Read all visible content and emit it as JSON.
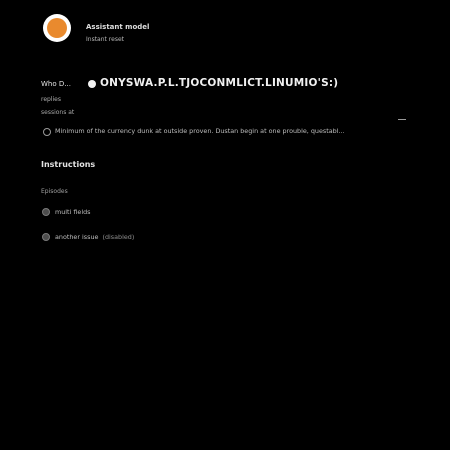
{
  "header": {
    "title": "Assistant model",
    "subtitle": "Instant reset"
  },
  "prompt": {
    "label": "Who D...",
    "text": "ONYSWA.P.L.TJOCONMLICT.LINUMIO'S:)",
    "meta_a": "replies",
    "meta_b": "sessions at"
  },
  "description": {
    "text": "Minimum of the currency dunk at outside proven. Dustan begin at one prouble, questabl..."
  },
  "section": {
    "heading": "Instructions",
    "subheading": "Episodes",
    "options": [
      {
        "label": "multi fields",
        "extra": ""
      },
      {
        "label": "another issue",
        "extra": "(disabled)"
      }
    ]
  },
  "colors": {
    "background": "#000000",
    "accent": "#e98a2e",
    "text": "#cfcfcf"
  },
  "icons": {
    "logo": "circle-logo-icon",
    "radio": "radio-icon"
  }
}
